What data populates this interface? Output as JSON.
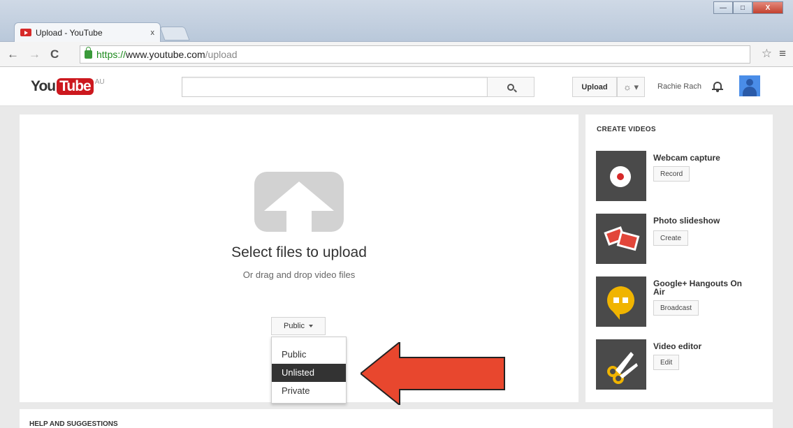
{
  "browser": {
    "tab_title": "Upload - YouTube",
    "tab_close": "x",
    "url_scheme": "https://",
    "url_host": "www.youtube.com",
    "url_path": "/upload",
    "back": "←",
    "forward": "→",
    "reload": "C",
    "star": "☆",
    "menu": "≡",
    "minimize": "—",
    "maximize": "□",
    "close": "X"
  },
  "header": {
    "logo_you": "You",
    "logo_tube": "Tube",
    "logo_region": "AU",
    "search_placeholder": "",
    "upload_label": "Upload",
    "gear": "☼ ▾",
    "user_name": "Rachie Rach"
  },
  "upload": {
    "title": "Select files to upload",
    "subtitle": "Or drag and drop video files",
    "privacy_selected": "Public",
    "privacy_options": [
      "Public",
      "Unlisted",
      "Private"
    ],
    "highlighted_option": "Unlisted"
  },
  "sidebar": {
    "title": "CREATE VIDEOS",
    "items": [
      {
        "title": "Webcam capture",
        "button": "Record"
      },
      {
        "title": "Photo slideshow",
        "button": "Create"
      },
      {
        "title": "Google+ Hangouts On Air",
        "button": "Broadcast"
      },
      {
        "title": "Video editor",
        "button": "Edit"
      }
    ]
  },
  "footer": {
    "help_title": "HELP AND SUGGESTIONS"
  },
  "colors": {
    "youtube_red": "#cc181e",
    "annotation_arrow": "#e8472e",
    "menu_selected": "#333333"
  }
}
